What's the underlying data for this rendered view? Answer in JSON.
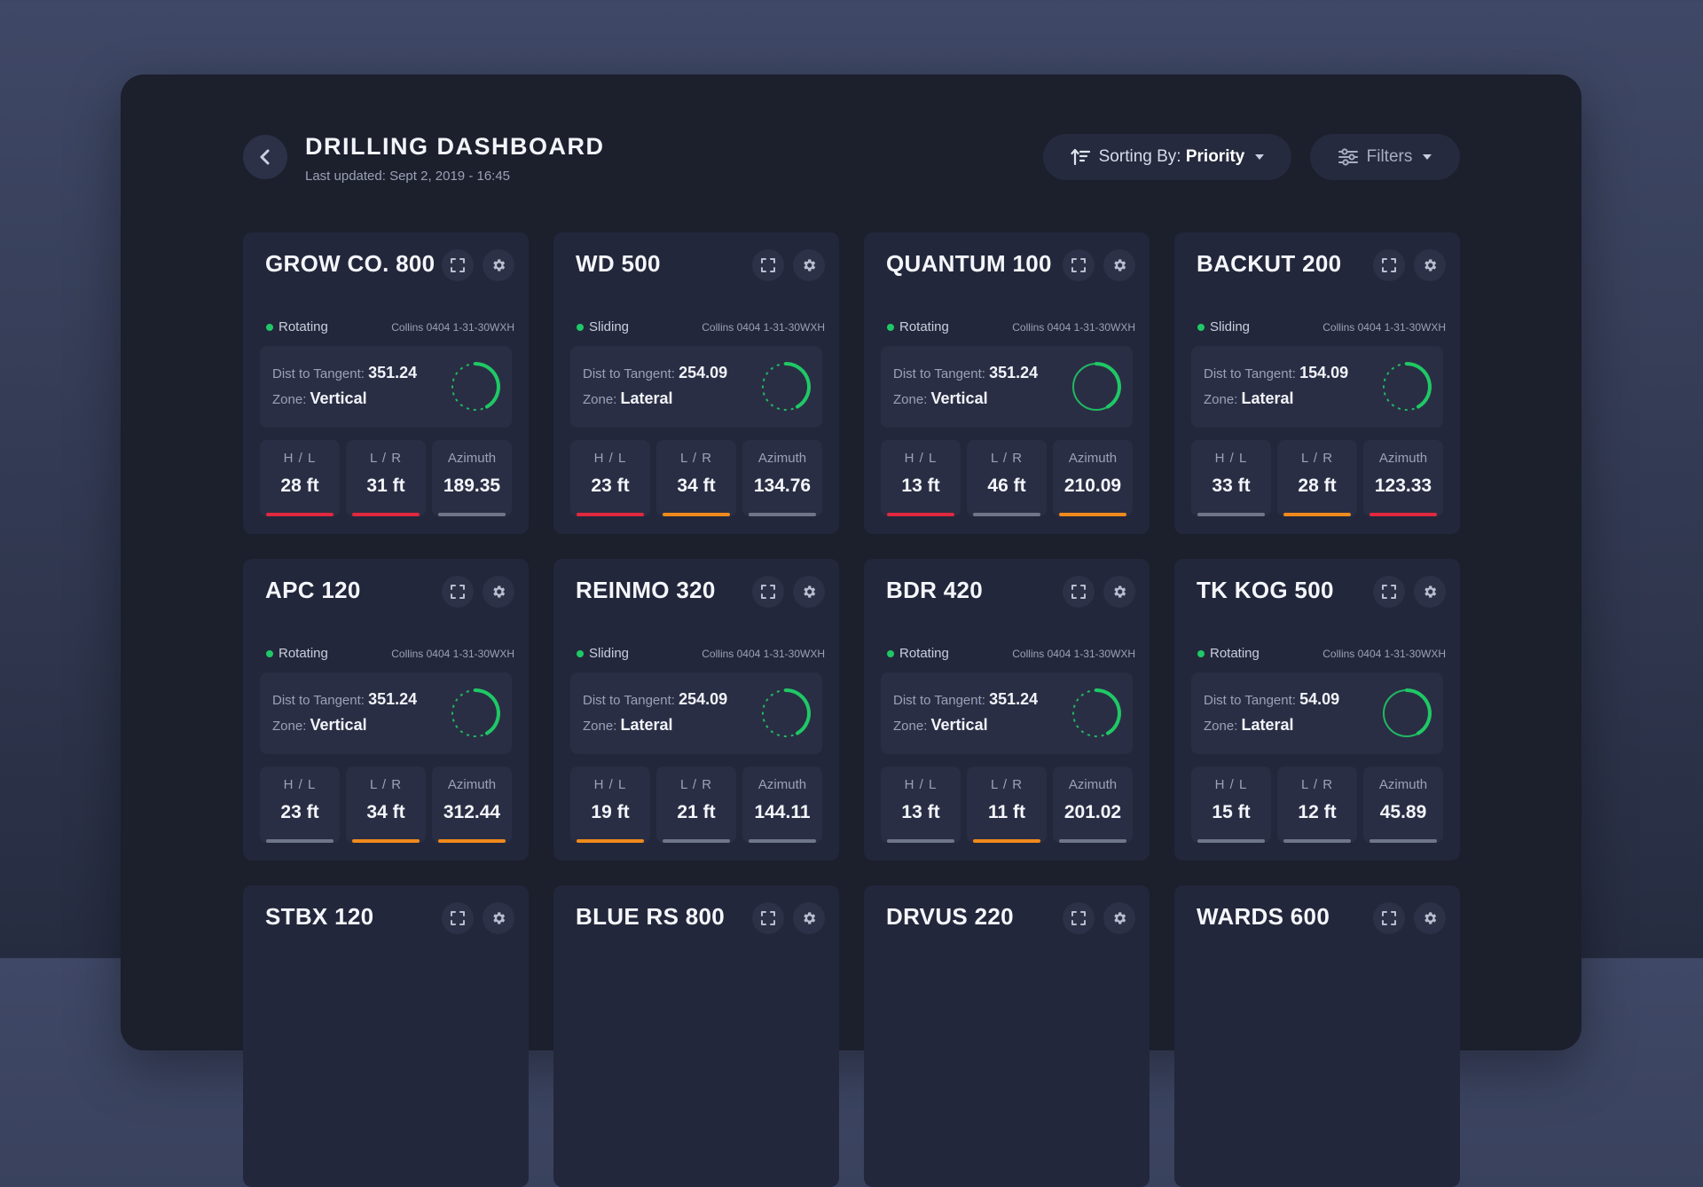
{
  "header": {
    "title": "DRILLING DASHBOARD",
    "last_updated": "Last updated: Sept 2, 2019 - 16:45",
    "sort_prefix": "Sorting By: ",
    "sort_value": "Priority",
    "filters_label": "Filters"
  },
  "labels": {
    "dist": "Dist to Tangent: ",
    "zone": "Zone: ",
    "hl": "H / L",
    "lr": "L / R",
    "azimuth": "Azimuth"
  },
  "colors": {
    "red": "#e0283f",
    "orange": "#f08a1c",
    "gray": "#70768a",
    "green": "#1fc866"
  },
  "rigs": [
    {
      "name": "GROW CO. 800",
      "status": "Rotating",
      "well": "Collins 0404 1-31-30WXH",
      "dist": "351.24",
      "zone": "Vertical",
      "ring": "dotted",
      "hl": "28 ft",
      "hl_color": "red",
      "lr": "31 ft",
      "lr_color": "red",
      "azimuth": "189.35",
      "az_color": "gray"
    },
    {
      "name": "WD 500",
      "status": "Sliding",
      "well": "Collins 0404 1-31-30WXH",
      "dist": "254.09",
      "zone": "Lateral",
      "ring": "dotted",
      "hl": "23 ft",
      "hl_color": "red",
      "lr": "34 ft",
      "lr_color": "orange",
      "azimuth": "134.76",
      "az_color": "gray"
    },
    {
      "name": "QUANTUM 100",
      "status": "Rotating",
      "well": "Collins 0404 1-31-30WXH",
      "dist": "351.24",
      "zone": "Vertical",
      "ring": "solid",
      "hl": "13 ft",
      "hl_color": "red",
      "lr": "46 ft",
      "lr_color": "gray",
      "azimuth": "210.09",
      "az_color": "orange"
    },
    {
      "name": "BACKUT 200",
      "status": "Sliding",
      "well": "Collins 0404 1-31-30WXH",
      "dist": "154.09",
      "zone": "Lateral",
      "ring": "dotted",
      "hl": "33 ft",
      "hl_color": "gray",
      "lr": "28 ft",
      "lr_color": "orange",
      "azimuth": "123.33",
      "az_color": "red"
    },
    {
      "name": "APC 120",
      "status": "Rotating",
      "well": "Collins 0404 1-31-30WXH",
      "dist": "351.24",
      "zone": "Vertical",
      "ring": "dotted",
      "hl": "23 ft",
      "hl_color": "gray",
      "lr": "34 ft",
      "lr_color": "orange",
      "azimuth": "312.44",
      "az_color": "orange"
    },
    {
      "name": "REINMO 320",
      "status": "Sliding",
      "well": "Collins 0404 1-31-30WXH",
      "dist": "254.09",
      "zone": "Lateral",
      "ring": "dotted",
      "hl": "19 ft",
      "hl_color": "orange",
      "lr": "21 ft",
      "lr_color": "gray",
      "azimuth": "144.11",
      "az_color": "gray"
    },
    {
      "name": "BDR 420",
      "status": "Rotating",
      "well": "Collins 0404 1-31-30WXH",
      "dist": "351.24",
      "zone": "Vertical",
      "ring": "dotted",
      "hl": "13 ft",
      "hl_color": "gray",
      "lr": "11 ft",
      "lr_color": "orange",
      "azimuth": "201.02",
      "az_color": "gray"
    },
    {
      "name": "TK KOG 500",
      "status": "Rotating",
      "well": "Collins 0404 1-31-30WXH",
      "dist": "54.09",
      "zone": "Lateral",
      "ring": "solid",
      "hl": "15 ft",
      "hl_color": "gray",
      "lr": "12 ft",
      "lr_color": "gray",
      "azimuth": "45.89",
      "az_color": "gray"
    },
    {
      "name": "STBX 120"
    },
    {
      "name": "BLUE RS 800"
    },
    {
      "name": "DRVUS 220"
    },
    {
      "name": "WARDS 600"
    }
  ]
}
